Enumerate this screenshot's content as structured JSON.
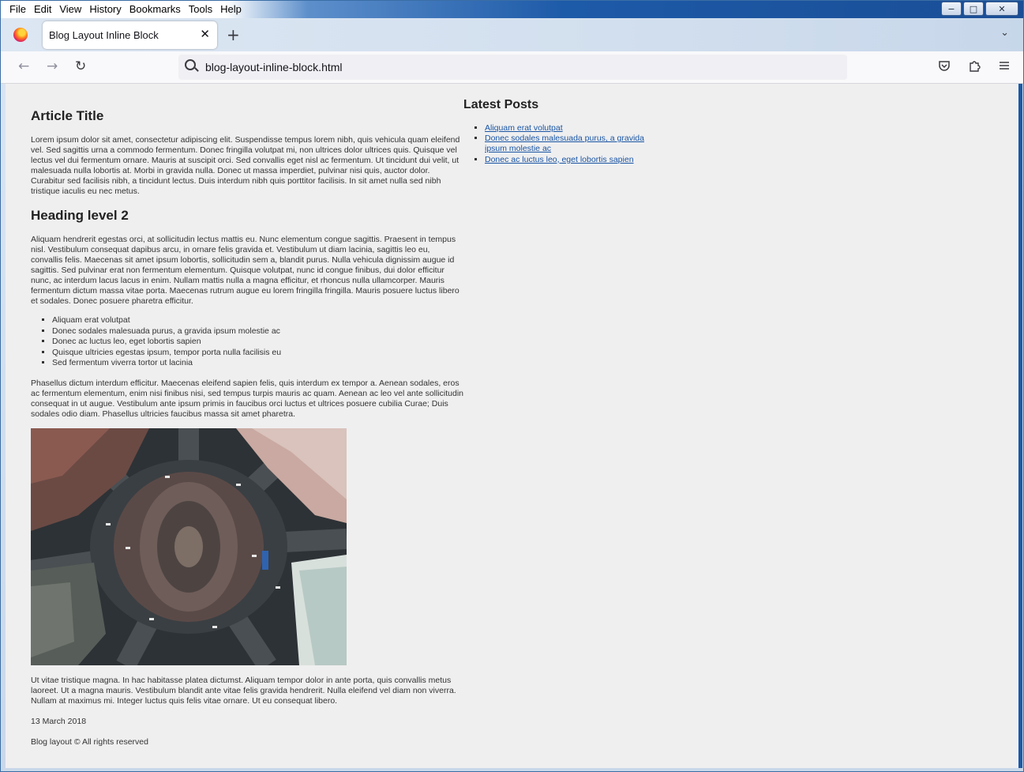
{
  "menubar": {
    "items": [
      "File",
      "Edit",
      "View",
      "History",
      "Bookmarks",
      "Tools",
      "Help"
    ]
  },
  "window_controls": {
    "minimize": "−",
    "maximize": "□",
    "close": "✕"
  },
  "tab": {
    "title": "Blog Layout Inline Block",
    "close": "✕",
    "new_tab": "+",
    "list": "⌄"
  },
  "navbar": {
    "url": "blog-layout-inline-block.html",
    "back": "←",
    "forward": "→",
    "reload": "↻",
    "icons": {
      "pocket": "pocket-icon",
      "extensions": "extensions-icon",
      "menu": "hamburger-menu-icon"
    }
  },
  "article": {
    "title": "Article Title",
    "para1": "Lorem ipsum dolor sit amet, consectetur adipiscing elit. Suspendisse tempus lorem nibh, quis vehicula quam eleifend vel. Sed sagittis urna a commodo fermentum. Donec fringilla volutpat mi, non ultrices dolor ultrices quis. Quisque vel lectus vel dui fermentum ornare. Mauris at suscipit orci. Sed convallis eget nisl ac fermentum. Ut tincidunt dui velit, ut malesuada nulla lobortis at. Morbi in gravida nulla. Donec ut massa imperdiet, pulvinar nisi quis, auctor dolor. Curabitur sed facilisis nibh, a tincidunt lectus. Duis interdum nibh quis porttitor facilisis. In sit amet nulla sed nibh tristique iaculis eu nec metus.",
    "heading2": "Heading level 2",
    "para2": "Aliquam hendrerit egestas orci, at sollicitudin lectus mattis eu. Nunc elementum congue sagittis. Praesent in tempus nisl. Vestibulum consequat dapibus arcu, in ornare felis gravida et. Vestibulum ut diam lacinia, sagittis leo eu, convallis felis. Maecenas sit amet ipsum lobortis, sollicitudin sem a, blandit purus. Nulla vehicula dignissim augue id sagittis. Sed pulvinar erat non fermentum elementum. Quisque volutpat, nunc id congue finibus, dui dolor efficitur nunc, ac interdum lacus lacus in enim. Nullam mattis nulla a magna efficitur, et rhoncus nulla ullamcorper. Mauris fermentum dictum massa vitae porta. Maecenas rutrum augue eu lorem fringilla fringilla. Mauris posuere luctus libero et sodales. Donec posuere pharetra efficitur.",
    "bullets": [
      "Aliquam erat volutpat",
      "Donec sodales malesuada purus, a gravida ipsum molestie ac",
      "Donec ac luctus leo, eget lobortis sapien",
      "Quisque ultricies egestas ipsum, tempor porta nulla facilisis eu",
      "Sed fermentum viverra tortor ut lacinia"
    ],
    "para3": "Phasellus dictum interdum efficitur. Maecenas eleifend sapien felis, quis interdum ex tempor a. Aenean sodales, eros ac fermentum elementum, enim nisi finibus nisi, sed tempus turpis mauris ac quam. Aenean ac leo vel ante sollicitudin consequat in ut augue. Vestibulum ante ipsum primis in faucibus orci luctus et ultrices posuere cubilia Curae; Duis sodales odio diam. Phasellus ultricies faucibus massa sit amet pharetra.",
    "para4": "Ut vitae tristique magna. In hac habitasse platea dictumst. Aliquam tempor dolor in ante porta, quis convallis metus laoreet. Ut a magna mauris. Vestibulum blandit ante vitae felis gravida hendrerit. Nulla eleifend vel diam non viverra. Nullam at maximus mi. Integer luctus quis felis vitae ornare. Ut eu consequat libero.",
    "date": "13 March 2018",
    "footer": "Blog layout © All rights reserved"
  },
  "sidebar": {
    "title": "Latest Posts",
    "links": [
      "Aliquam erat volutpat",
      "Donec sodales malesuada purus, a gravida ipsum molestie ac",
      "Donec ac luctus leo, eget lobortis sapien"
    ]
  }
}
